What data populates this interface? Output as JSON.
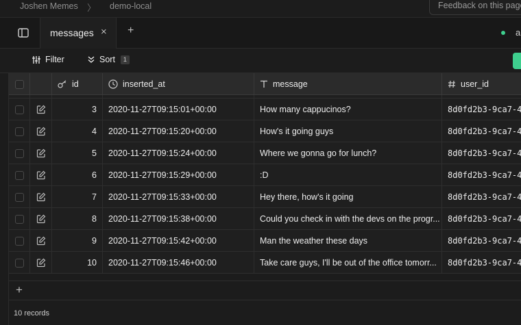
{
  "breadcrumb": {
    "project": "Joshen Memes",
    "separator": "〉",
    "branch": "demo-local"
  },
  "header": {
    "feedback_label": "Feedback on this page"
  },
  "tabs": [
    {
      "label": "messages",
      "close": "×"
    }
  ],
  "tab_add": "+",
  "status": {
    "label": "all",
    "color": "#3ecf8e"
  },
  "toolbar": {
    "filter_label": "Filter",
    "sort_label": "Sort",
    "sort_count": "1"
  },
  "columns": {
    "id": "id",
    "inserted_at": "inserted_at",
    "message": "message",
    "user_id": "user_id"
  },
  "rows": [
    {
      "id": "3",
      "inserted_at": "2020-11-27T09:15:01+00:00",
      "message": "How many cappucinos?",
      "user_id": "8d0fd2b3-9ca7-4"
    },
    {
      "id": "4",
      "inserted_at": "2020-11-27T09:15:20+00:00",
      "message": "How's it going guys",
      "user_id": "8d0fd2b3-9ca7-4"
    },
    {
      "id": "5",
      "inserted_at": "2020-11-27T09:15:24+00:00",
      "message": "Where we gonna go for lunch?",
      "user_id": "8d0fd2b3-9ca7-4"
    },
    {
      "id": "6",
      "inserted_at": "2020-11-27T09:15:29+00:00",
      "message": ":D",
      "user_id": "8d0fd2b3-9ca7-4"
    },
    {
      "id": "7",
      "inserted_at": "2020-11-27T09:15:33+00:00",
      "message": "Hey there, how's it going",
      "user_id": "8d0fd2b3-9ca7-4"
    },
    {
      "id": "8",
      "inserted_at": "2020-11-27T09:15:38+00:00",
      "message": "Could you check in with the devs on the progr...",
      "user_id": "8d0fd2b3-9ca7-4"
    },
    {
      "id": "9",
      "inserted_at": "2020-11-27T09:15:42+00:00",
      "message": "Man the weather these days",
      "user_id": "8d0fd2b3-9ca7-4"
    },
    {
      "id": "10",
      "inserted_at": "2020-11-27T09:15:46+00:00",
      "message": "Take care guys, I'll be out of the office tomorr...",
      "user_id": "8d0fd2b3-9ca7-4"
    }
  ],
  "add_row": "+",
  "footer": {
    "record_count": "10 records"
  },
  "colors": {
    "accent": "#3ecf8e",
    "background": "#1c1c1c",
    "header": "#2b2b2b"
  }
}
